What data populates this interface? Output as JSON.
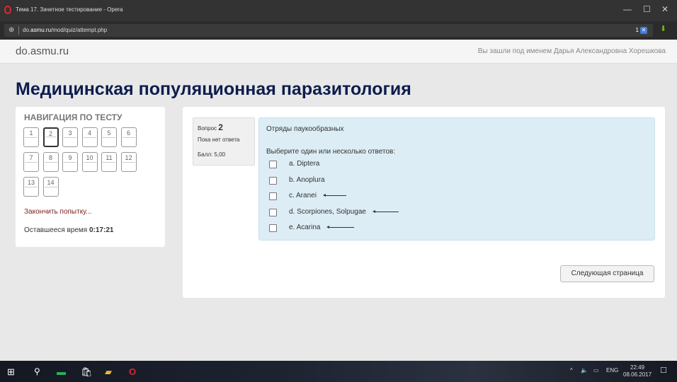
{
  "window": {
    "title": "Тема 17. Зачетное тестирование - Opera",
    "min": "—",
    "max": "☐",
    "close": "✕"
  },
  "address": {
    "url_prefix": "do.",
    "url_domain": "asmu.ru",
    "url_path": "/mod/quiz/attempt.php",
    "ad_count": "1",
    "ad_badge": "✕"
  },
  "site": {
    "name": "do.asmu.ru",
    "user_text": "Вы зашли под именем Дарья Александровна Хорешкова"
  },
  "page": {
    "title": "Медицинская популяционная паразитология"
  },
  "nav": {
    "title": "НАВИГАЦИЯ ПО ТЕСТУ",
    "questions": [
      "1",
      "2",
      "3",
      "4",
      "5",
      "6",
      "7",
      "8",
      "9",
      "10",
      "11",
      "12",
      "13",
      "14"
    ],
    "current": "2",
    "finish": "Закончить попытку...",
    "time_label": "Оставшееся время",
    "time_value": "0:17:21"
  },
  "question": {
    "label": "Вопрос",
    "number": "2",
    "state": "Пока нет ответа",
    "mark": "Балл: 5,00",
    "text": "Отряды паукообразных",
    "prompt": "Выберите один или несколько ответов:",
    "options": [
      {
        "text": "a. Diptera",
        "checked": false,
        "arrow": false
      },
      {
        "text": "b. Anoplura",
        "checked": false,
        "arrow": false
      },
      {
        "text": "c. Aranei",
        "checked": false,
        "arrow": true
      },
      {
        "text": "d. Scorpiones, Solpugae",
        "checked": false,
        "arrow": true
      },
      {
        "text": "e. Acarina",
        "checked": false,
        "arrow": true
      }
    ]
  },
  "next_button": "Следующая страница",
  "taskbar": {
    "lang": "ENG",
    "time": "22:49",
    "date": "08.06.2017"
  }
}
